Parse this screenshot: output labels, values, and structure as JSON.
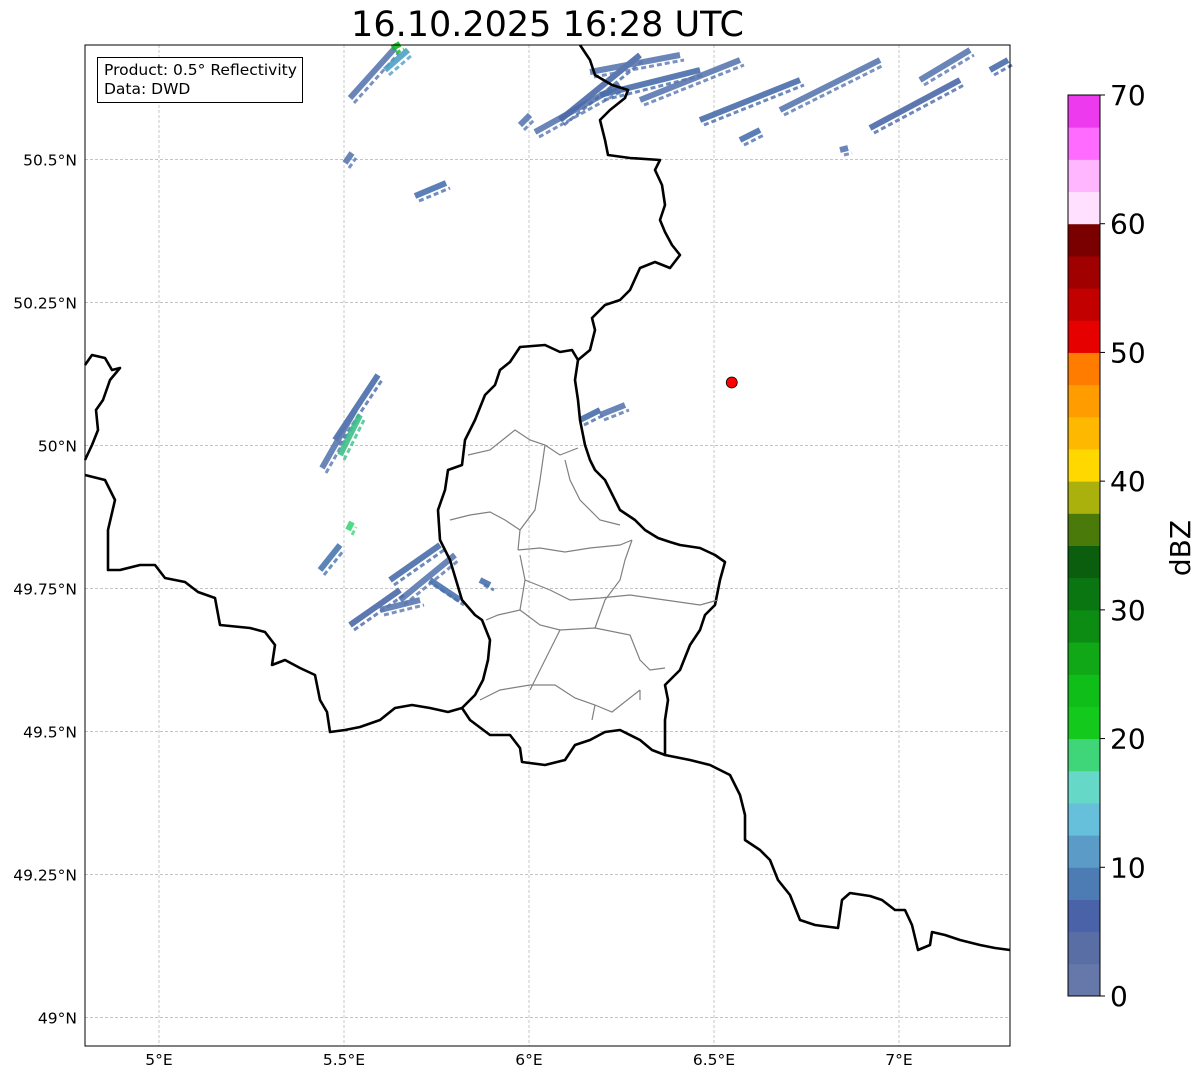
{
  "title": "16.10.2025 16:28 UTC",
  "info_box": {
    "product": "Product: 0.5° Reflectivity",
    "data": "Data: DWD"
  },
  "map": {
    "lon_range": [
      4.8,
      7.3
    ],
    "lat_range": [
      48.95,
      50.7
    ],
    "lon_ticks": [
      {
        "value": 5.0,
        "label": "5°E"
      },
      {
        "value": 5.5,
        "label": "5.5°E"
      },
      {
        "value": 6.0,
        "label": "6°E"
      },
      {
        "value": 6.5,
        "label": "6.5°E"
      },
      {
        "value": 7.0,
        "label": "7°E"
      }
    ],
    "lat_ticks": [
      {
        "value": 49.0,
        "label": "49°N"
      },
      {
        "value": 49.25,
        "label": "49.25°N"
      },
      {
        "value": 49.5,
        "label": "49.5°N"
      },
      {
        "value": 49.75,
        "label": "49.75°N"
      },
      {
        "value": 50.0,
        "label": "50°N"
      },
      {
        "value": 50.25,
        "label": "50.25°N"
      },
      {
        "value": 50.5,
        "label": "50.5°N"
      }
    ],
    "grid": true,
    "radar_site": {
      "lon": 6.548,
      "lat": 50.11,
      "color": "#ff0000"
    }
  },
  "colorbar": {
    "label": "dBZ",
    "range": [
      0,
      70
    ],
    "ticks": [
      0,
      10,
      20,
      30,
      40,
      50,
      60,
      70
    ],
    "colors": [
      "#6677aa",
      "#5a6ea6",
      "#4a62a8",
      "#4c7cb3",
      "#5a9bc8",
      "#66c0dc",
      "#66d8c8",
      "#3fd67a",
      "#12c91c",
      "#10be1a",
      "#10a816",
      "#0c8c12",
      "#0a7612",
      "#0a5e0e",
      "#4a7a0a",
      "#aab10c",
      "#ffd800",
      "#ffb800",
      "#ff9c00",
      "#ff7c00",
      "#e60000",
      "#c30000",
      "#a00000",
      "#7a0000",
      "#ffe0ff",
      "#ffb6ff",
      "#ff6aff",
      "#ee3aee"
    ]
  }
}
